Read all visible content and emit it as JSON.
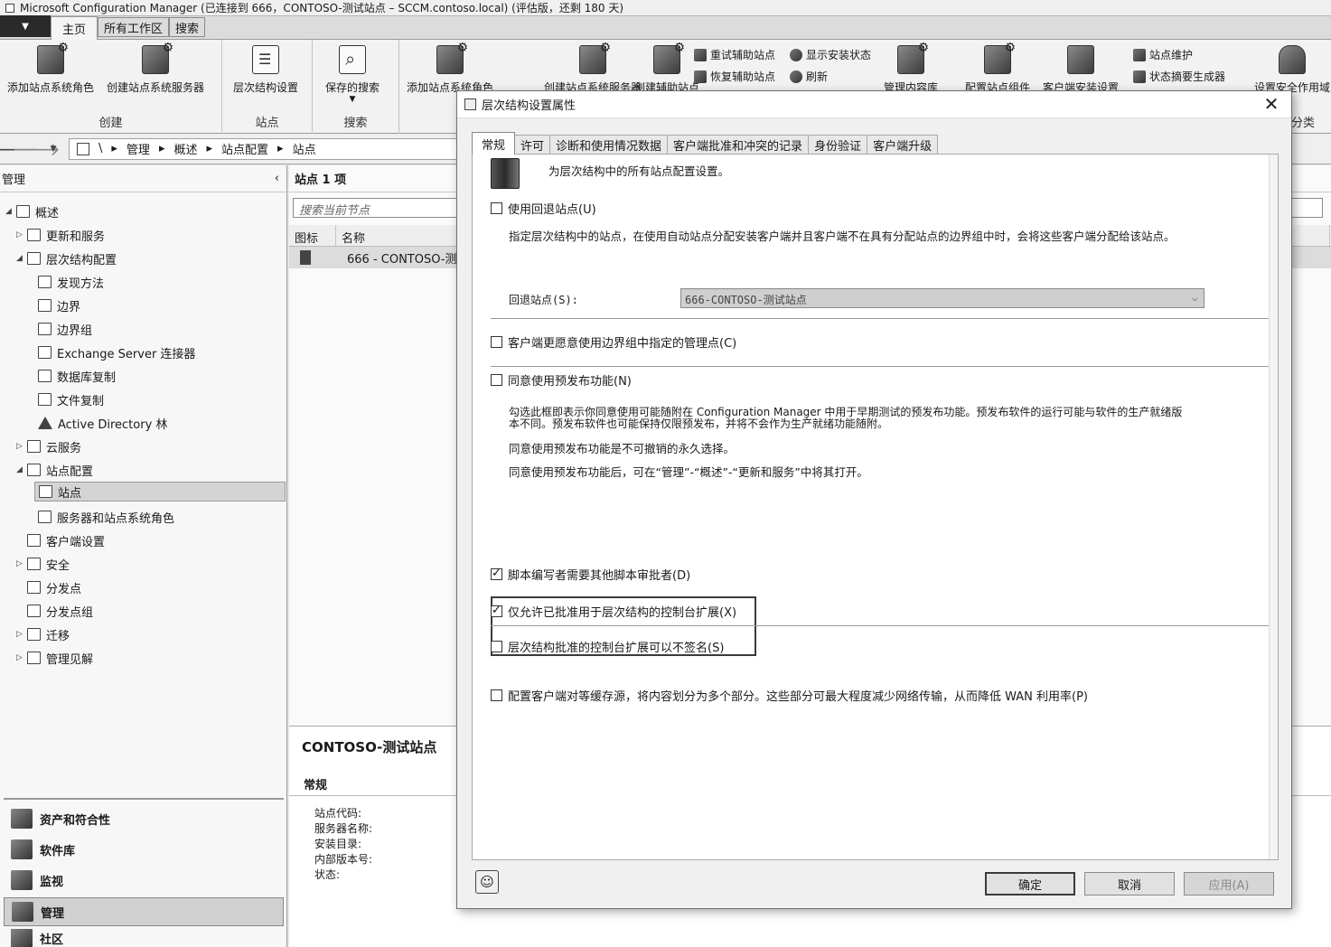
{
  "window": {
    "title": "Microsoft Configuration Manager (已连接到 666，CONTOSO-测试站点 – SCCM.contoso.local) (评估版，还剩 180 天)"
  },
  "ribbon": {
    "tabs": [
      "主页",
      "所有工作区",
      "搜索"
    ],
    "groups": {
      "create": {
        "label": "创建",
        "buttons": [
          "添加站点系统角色",
          "创建站点系统服务器"
        ]
      },
      "site": {
        "label": "站点",
        "buttons": [
          "层次结构设置"
        ]
      },
      "search": {
        "label": "搜索",
        "buttons": [
          "保存的搜索"
        ]
      },
      "more": {
        "buttons": [
          "添加站点系统角色",
          "创建站点系统服务器",
          "创建辅助站点"
        ],
        "small_buttons": [
          "重试辅助站点",
          "恢复辅助站点",
          "显示安装状态",
          "刷新",
          "管理内容库",
          "配置站点组件",
          "客户端安装设置",
          "站点维护",
          "状态摘要生成器",
          "设置安全作用域"
        ],
        "category_label": "分类"
      }
    }
  },
  "address": {
    "crumbs": [
      "\\",
      "管理",
      "概述",
      "站点配置",
      "站点"
    ]
  },
  "nav": {
    "title": "管理",
    "items": [
      "概述",
      "更新和服务",
      "层次结构配置",
      "发现方法",
      "边界",
      "边界组",
      "Exchange Server 连接器",
      "数据库复制",
      "文件复制",
      "Active Directory 林",
      "云服务",
      "站点配置",
      "站点",
      "服务器和站点系统角色",
      "客户端设置",
      "安全",
      "分发点",
      "分发点组",
      "迁移",
      "管理见解"
    ],
    "workspaces": [
      "资产和符合性",
      "软件库",
      "监视",
      "管理",
      "社区"
    ]
  },
  "content": {
    "title": "站点 1 项",
    "search_placeholder": "搜索当前节点",
    "columns": [
      "图标",
      "名称"
    ],
    "row_name": "666 - CONTOSO-测试站点",
    "detail": {
      "title": "CONTOSO-测试站点",
      "section": "常规",
      "fields": [
        "站点代码:",
        "服务器名称:",
        "安装目录:",
        "内部版本号:",
        "状态:"
      ]
    }
  },
  "dialog": {
    "title": "层次结构设置属性",
    "tabs": [
      "常规",
      "许可",
      "诊断和使用情况数据",
      "客户端批准和冲突的记录",
      "身份验证",
      "客户端升级"
    ],
    "header_text": "为层次结构中的所有站点配置设置。",
    "fallback_checkbox": "使用回退站点(U)",
    "fallback_desc": "指定层次结构中的站点，在使用自动站点分配安装客户端并且客户端不在具有分配站点的边界组中时，会将这些客户端分配给该站点。",
    "fallback_label": "回退站点(S):",
    "fallback_value": "666-CONTOSO-测试站点",
    "prefer_mp_checkbox": "客户端更愿意使用边界组中指定的管理点(C)",
    "prerelease_checkbox": "同意使用预发布功能(N)",
    "prerelease_desc_1": "勾选此框即表示你同意使用可能随附在 Configuration Manager 中用于早期测试的预发布功能。预发布软件的运行可能与软件的生产就绪版",
    "prerelease_desc_2": "本不同。预发布软件也可能保持仅限预发布，并将不会作为生产就绪功能随附。",
    "prerelease_desc_3": "同意使用预发布功能是不可撤销的永久选择。",
    "prerelease_desc_4": "同意使用预发布功能后，可在“管理”-“概述”-“更新和服务”中将其打开。",
    "script_approver_checkbox": "脚本编写者需要其他脚本审批者(D)",
    "approved_ext_checkbox": "仅允许已批准用于层次结构的控制台扩展(X)",
    "unsigned_ext_checkbox": "层次结构批准的控制台扩展可以不签名(S)",
    "peer_cache_checkbox": "配置客户端对等缓存源，将内容划分为多个部分。这些部分可最大程度减少网络传输，从而降低 WAN 利用率(P)",
    "buttons": {
      "ok": "确定",
      "cancel": "取消",
      "apply": "应用(A)"
    }
  }
}
